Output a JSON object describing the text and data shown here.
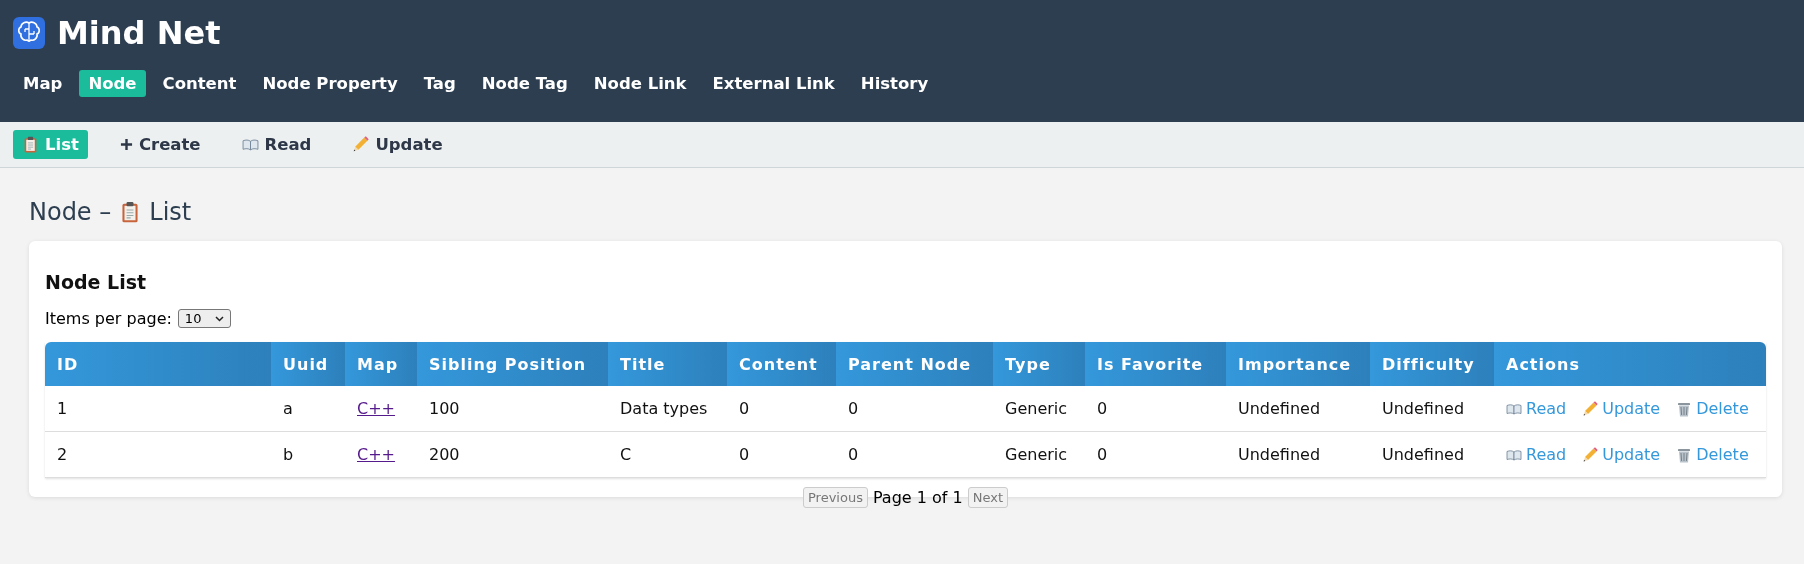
{
  "app": {
    "title": "Mind Net"
  },
  "nav": [
    {
      "label": "Map",
      "selected": false
    },
    {
      "label": "Node",
      "selected": true
    },
    {
      "label": "Content",
      "selected": false
    },
    {
      "label": "Node Property",
      "selected": false
    },
    {
      "label": "Tag",
      "selected": false
    },
    {
      "label": "Node Tag",
      "selected": false
    },
    {
      "label": "Node Link",
      "selected": false
    },
    {
      "label": "External Link",
      "selected": false
    },
    {
      "label": "History",
      "selected": false
    }
  ],
  "subnav": [
    {
      "label": "List",
      "kind": "list",
      "selected": true
    },
    {
      "label": "Create",
      "kind": "create",
      "selected": false
    },
    {
      "label": "Read",
      "kind": "read",
      "selected": false
    },
    {
      "label": "Update",
      "kind": "update",
      "selected": false
    }
  ],
  "page_heading": {
    "prefix": "Node –",
    "label": "List"
  },
  "card": {
    "title": "Node List",
    "page_size_label": "Items per page:",
    "page_size": "10",
    "table": {
      "columns": [
        "ID",
        "Uuid",
        "Map",
        "Sibling Position",
        "Title",
        "Content",
        "Parent Node",
        "Type",
        "Is Favorite",
        "Importance",
        "Difficulty",
        "Actions"
      ],
      "rows": [
        {
          "cells": [
            "1",
            "a",
            "C++",
            "100",
            "Data types",
            "0",
            "0",
            "Generic",
            "0",
            "Undefined",
            "Undefined"
          ],
          "actions": [
            {
              "label": "Read",
              "kind": "read"
            },
            {
              "label": "Update",
              "kind": "update"
            },
            {
              "label": "Delete",
              "kind": "delete"
            }
          ]
        },
        {
          "cells": [
            "2",
            "b",
            "C++",
            "200",
            "C",
            "0",
            "0",
            "Generic",
            "0",
            "Undefined",
            "Undefined"
          ],
          "actions": [
            {
              "label": "Read",
              "kind": "read"
            },
            {
              "label": "Update",
              "kind": "update"
            },
            {
              "label": "Delete",
              "kind": "delete"
            }
          ]
        }
      ]
    },
    "pagination": {
      "previous": "Previous",
      "status": "Page 1 of 1",
      "next": "Next"
    }
  }
}
